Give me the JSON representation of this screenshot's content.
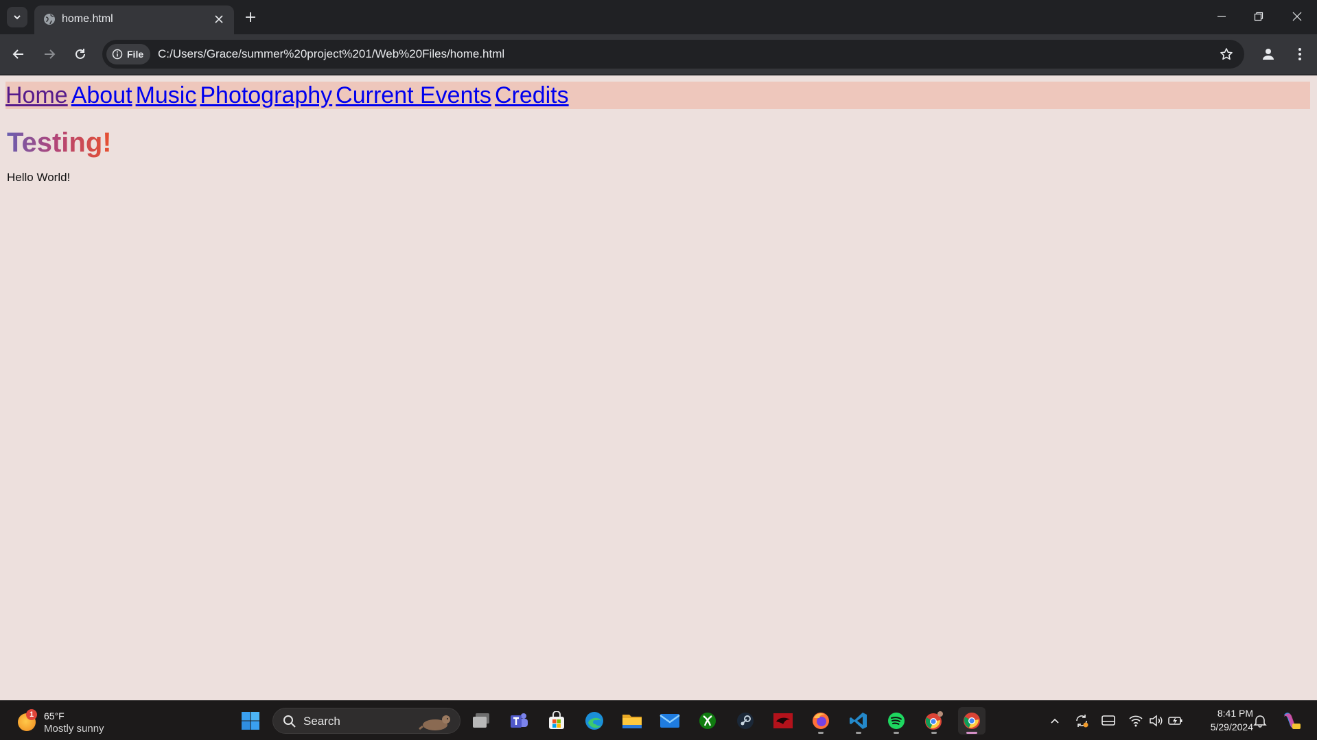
{
  "browser": {
    "tab_title": "home.html",
    "site_chip_label": "File",
    "url": "C:/Users/Grace/summer%20project%201/Web%20Files/home.html"
  },
  "page": {
    "nav_links": [
      "Home",
      "About",
      "Music",
      "Photography",
      "Current Events",
      "Credits"
    ],
    "heading": "Testing!",
    "paragraph": "Hello World!"
  },
  "taskbar": {
    "weather_temp": "65°F",
    "weather_condition": "Mostly sunny",
    "weather_badge": "1",
    "search_label": "Search",
    "pinned_apps": [
      "task-view",
      "teams",
      "microsoft-store",
      "edge",
      "file-explorer",
      "mail",
      "xbox",
      "steam",
      "app-red",
      "firefox",
      "vscode",
      "spotify",
      "chrome-canary",
      "chrome"
    ],
    "clock_time": "8:41 PM",
    "clock_date": "5/29/2024"
  },
  "colors": {
    "page_background": "#ede0dd",
    "navbar_background": "#eec7bc",
    "link": "#0000ee",
    "visited_link": "#551a8b",
    "heading_gradient": [
      "#6a5fb0",
      "#b0457a",
      "#e8502e"
    ]
  }
}
